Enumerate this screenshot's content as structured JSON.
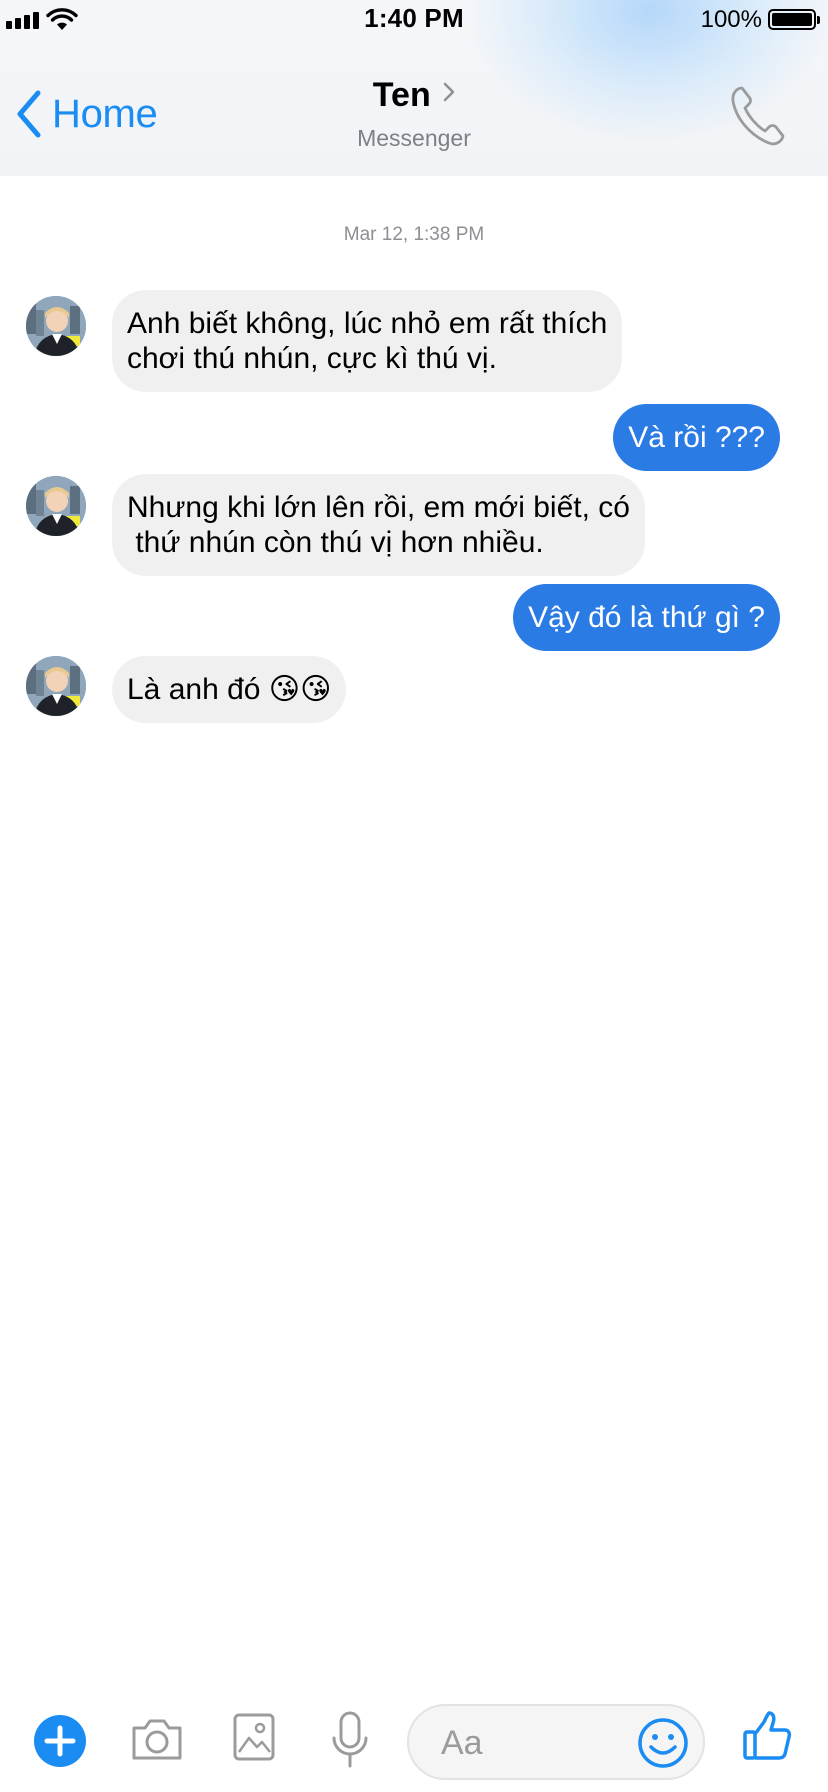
{
  "status_bar": {
    "time": "1:40 PM",
    "battery": "100%"
  },
  "header": {
    "back_label": "Home",
    "contact_name": "Ten",
    "subtitle": "Messenger"
  },
  "conversation": {
    "timestamp": "Mar 12, 1:38 PM",
    "messages": [
      {
        "from": "them",
        "text": "Anh biết không, lúc nhỏ em rất thích\nchơi thú nhún, cực kì thú vị."
      },
      {
        "from": "me",
        "text": "Và rồi ???"
      },
      {
        "from": "them",
        "text": "Nhưng khi lớn lên rồi, em mới biết, có\n thứ nhún còn thú vị hơn nhiều."
      },
      {
        "from": "me",
        "text": "Vậy đó là thứ gì ?"
      },
      {
        "from": "them",
        "text": "Là anh đó 😘😘"
      }
    ]
  },
  "composer": {
    "placeholder": "Aa"
  },
  "icons": [
    "back-chevron-icon",
    "chevron-right-icon",
    "phone-icon",
    "plus-icon",
    "camera-icon",
    "image-icon",
    "microphone-icon",
    "emoji-icon",
    "thumbs-up-icon"
  ],
  "colors": {
    "accent": "#1a8cf2",
    "outgoing_bubble": "#2b7be5",
    "incoming_bubble": "#f1f0f0"
  }
}
